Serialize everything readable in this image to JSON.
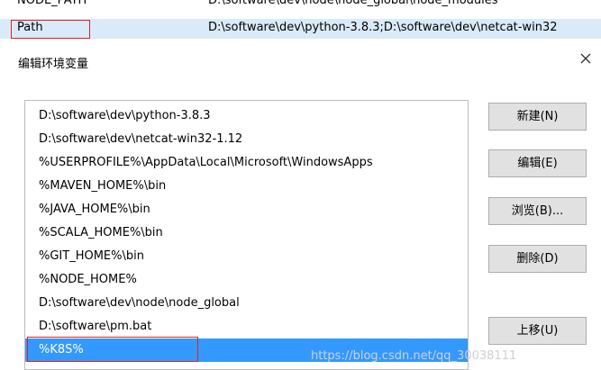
{
  "env_table": {
    "rows": [
      {
        "name": "NODE_PATH",
        "value": "D:\\software\\dev\\node\\node_global\\node_modules"
      },
      {
        "name": "Path",
        "value": "D:\\software\\dev\\python-3.8.3;D:\\software\\dev\\netcat-win32"
      }
    ]
  },
  "dialog": {
    "title": "编辑环境变量",
    "close": "✕"
  },
  "list": {
    "items": [
      "D:\\software\\dev\\python-3.8.3",
      "D:\\software\\dev\\netcat-win32-1.12",
      "%USERPROFILE%\\AppData\\Local\\Microsoft\\WindowsApps",
      "%MAVEN_HOME%\\bin",
      "%JAVA_HOME%\\bin",
      "%SCALA_HOME%\\bin",
      "%GIT_HOME%\\bin",
      "%NODE_HOME%",
      "D:\\software\\dev\\node\\node_global",
      "D:\\software\\pm.bat",
      "%K8S%"
    ],
    "selected_index": 10
  },
  "buttons": {
    "new": "新建(N)",
    "edit": "编辑(E)",
    "browse": "浏览(B)...",
    "delete": "删除(D)",
    "move_up": "上移(U)"
  },
  "watermark": "https://blog.csdn.net/qq_30038111"
}
